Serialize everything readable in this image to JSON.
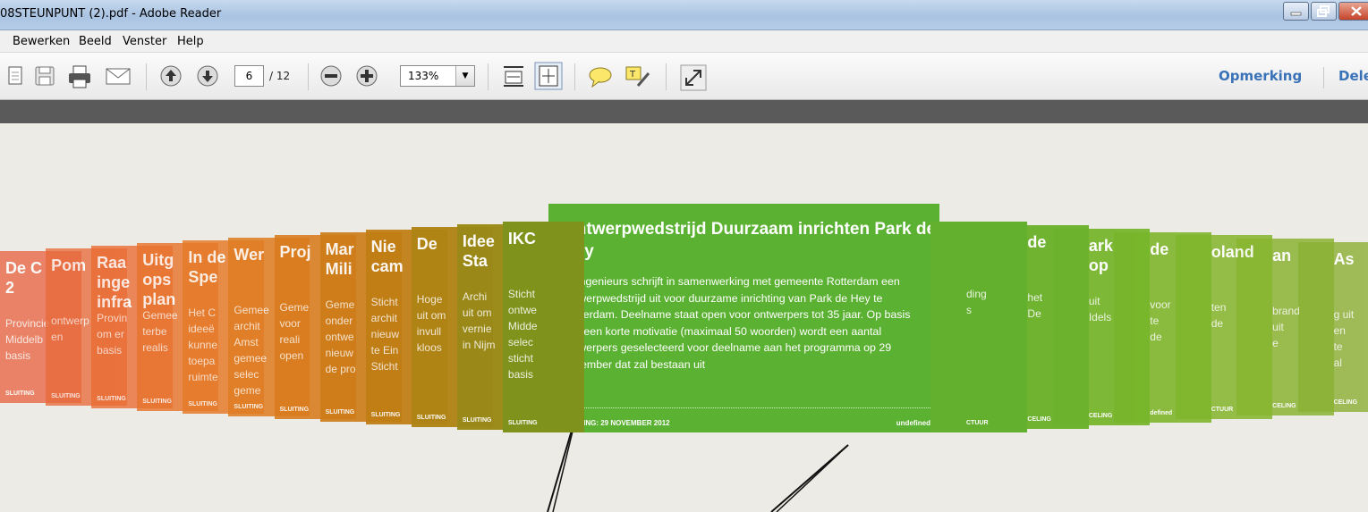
{
  "window": {
    "title": "08STEUNPUNT (2).pdf - Adobe Reader"
  },
  "menu": {
    "items": [
      "Bewerken",
      "Beeld",
      "Venster",
      "Help"
    ]
  },
  "toolbar": {
    "page_current": "6",
    "page_total": "/ 12",
    "zoom": "133%",
    "comment_link": "Opmerking",
    "share_link": "Dele"
  },
  "cards_left": [
    {
      "title": "De C\n2",
      "body": "Provincie\nMiddelb\nbasis",
      "color": "#e8603c"
    },
    {
      "title": "Pom",
      "body": "ontwerp\nen",
      "color": "#e86a3a"
    },
    {
      "title": "Raa\ninge\ninfra",
      "body": "Provin\nom er\nbasis",
      "color": "#ea6d34"
    },
    {
      "title": "Uitg\nops\nplan",
      "body": "Gemee\nterbe\nrealis",
      "color": "#e8742e"
    },
    {
      "title": "In de\nSpe",
      "body": "Het C\nideeë\nkunne\ntoepa\nruimte",
      "color": "#e57a28"
    },
    {
      "title": "Wer",
      "body": "Gemee\narchit\nAmst\ngemee\nselec\ngeme",
      "color": "#e07e22"
    },
    {
      "title": "Proj",
      "body": "Geme\nvoor\nreali\nopen",
      "color": "#d87c1d"
    },
    {
      "title": "Mar\nMili",
      "body": "Geme\nonder\nontwe\nnieuw\nde pro",
      "color": "#cd7c18"
    },
    {
      "title": "Nie\ncam",
      "body": "Sticht\narchit\nnieuw\nte Ein\nSticht",
      "color": "#c07e14"
    },
    {
      "title": "De",
      "body": "Hoge\nuit om\ninvull\nkloos",
      "color": "#b08414"
    },
    {
      "title": "Idee\nSta",
      "body": "Archi\nuit om\nvernie\nin Nijm",
      "color": "#9a8a18"
    },
    {
      "title": "IKC",
      "body": "Sticht\nontwe\nMidde\nselec\nsticht\nbasis",
      "color": "#7f931c"
    }
  ],
  "cards_right": [
    {
      "title": "",
      "body": "ding\ns",
      "color": "#63b02e"
    },
    {
      "title": "de",
      "body": "het\nDe",
      "color": "#6cb22c"
    },
    {
      "title": "ark\nop",
      "body": "uit\nIdels",
      "color": "#77b52b"
    },
    {
      "title": "de",
      "body": "voor\nte\nde",
      "color": "#80b62d"
    },
    {
      "title": "oland",
      "body": "ten\nde",
      "color": "#87b62f"
    },
    {
      "title": "an",
      "body": "brand\nuit\ne",
      "color": "#8ab332"
    },
    {
      "title": "As",
      "body": "g uit\nen\nte\nal",
      "color": "#8db035"
    }
  ],
  "featured": {
    "title": "Ontwerpwedstrijd Duurzaam inrichten Park de Hey",
    "body": "NLingenieurs schrijft in samenwerking met gemeente Rotterdam een ontwerpwedstrijd uit voor duurzame inrichting van Park de Hey te Rotterdam. Deelname staat open voor ontwerpers tot 35 jaar. Op basis van een korte motivatie (maximaal 50 woorden) wordt een aantal ontwerpers geselecteerd voor deelname aan het programma op 29 november dat zal bestaan uit",
    "sluiting": "SLUITING: 29 NOVEMBER 2012",
    "footer_right": "undefined",
    "color": "#5bb131"
  },
  "footer_fragments_right": [
    "CTUUR",
    "CELING",
    "CELING",
    "defined",
    "CTUUR",
    "CELING",
    "CELING",
    "CTUUR",
    "CELING"
  ]
}
